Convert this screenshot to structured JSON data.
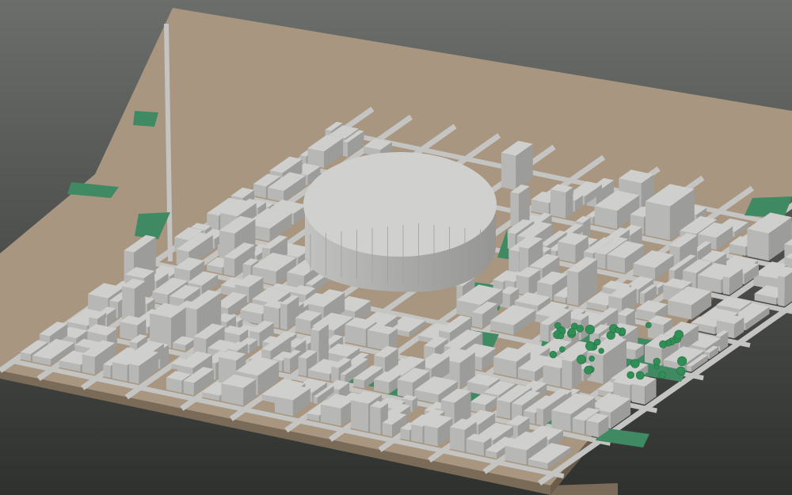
{
  "scene": {
    "subject": "3d-city-model",
    "colors": {
      "background_top": "#6b6e6b",
      "background_bottom": "#2f312f",
      "ground": "#a89680",
      "ground_edge": "#7a6b58",
      "road": "#c4c4c2",
      "building_roof": "#cfcfcd",
      "building_left": "#b7b7b5",
      "building_right": "#9c9c9a",
      "park": "#3f8a63",
      "tree": "#2f8f55",
      "arena_roof": "#d0d0ce",
      "arena_wall": "#a9a9a7"
    }
  }
}
